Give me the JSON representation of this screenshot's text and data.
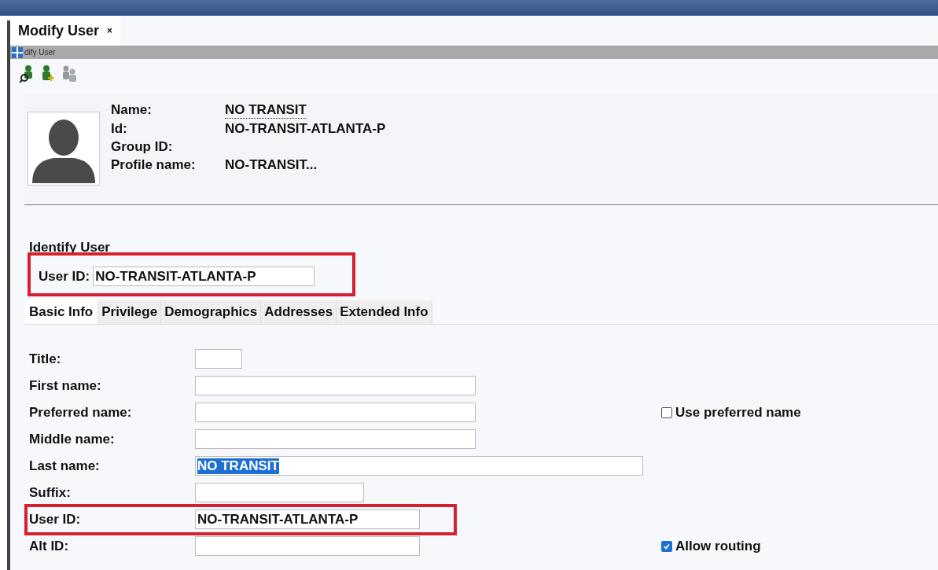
{
  "document_tab": {
    "label": "Modify User",
    "close": "×"
  },
  "subheader": {
    "title": "dify User"
  },
  "profile": {
    "fields": [
      {
        "label": "Name:",
        "value": "NO TRANSIT",
        "link": true
      },
      {
        "label": "Id:",
        "value": "NO-TRANSIT-ATLANTA-P",
        "link": false
      },
      {
        "label": "Group ID:"
      },
      {
        "label": "Profile name:",
        "value": "NO-TRANSIT...",
        "link": false
      }
    ]
  },
  "identify": {
    "title": "Identify User",
    "label": "User ID:",
    "value": "NO-TRANSIT-ATLANTA-P",
    "highlighted": true
  },
  "tabs": [
    {
      "label": "Basic Info",
      "selected": true
    },
    {
      "label": "Privilege",
      "selected": false
    },
    {
      "label": "Demographics",
      "selected": false
    },
    {
      "label": "Addresses",
      "selected": false
    },
    {
      "label": "Extended Info",
      "selected": false
    }
  ],
  "form": [
    {
      "label": "Title:",
      "highlighted": false
    },
    {
      "label": "First name:",
      "highlighted": false
    },
    {
      "label": "Preferred name:",
      "highlighted": false,
      "option": {
        "label": "Use preferred name",
        "checked": false
      }
    },
    {
      "label": "Middle name:",
      "highlighted": false
    },
    {
      "label": "Last name:",
      "value": "NO TRANSIT",
      "text_selected": true,
      "highlighted": false
    },
    {
      "label": "Suffix:",
      "highlighted": false
    },
    {
      "label": "User ID:",
      "value": "NO-TRANSIT-ATLANTA-P",
      "text_selected": false,
      "highlighted": true
    },
    {
      "label": "Alt ID:",
      "highlighted": false,
      "option": {
        "label": "Allow routing",
        "checked": true
      }
    }
  ]
}
